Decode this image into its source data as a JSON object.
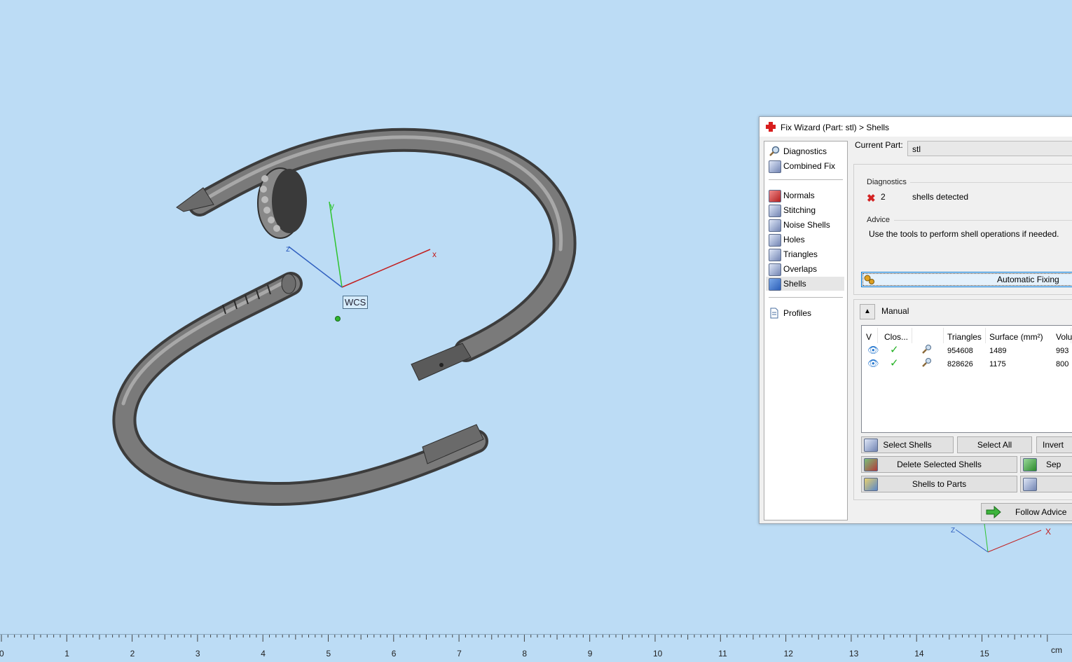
{
  "viewport": {
    "wcs_label": "WCS",
    "axis_x": "x",
    "axis_y": "y",
    "axis_z": "z",
    "mini_axis_x": "X",
    "mini_axis_z": "Z"
  },
  "ruler": {
    "unit": "cm",
    "ticks": [
      "0",
      "1",
      "2",
      "3",
      "4",
      "5",
      "6",
      "7",
      "8",
      "9",
      "10",
      "11",
      "12",
      "13",
      "14",
      "15"
    ]
  },
  "dialog": {
    "title": "Fix Wizard (Part: stl) > Shells",
    "nav": {
      "diagnostics": "Diagnostics",
      "combined_fix": "Combined Fix",
      "normals": "Normals",
      "stitching": "Stitching",
      "noise_shells": "Noise Shells",
      "holes": "Holes",
      "triangles": "Triangles",
      "overlaps": "Overlaps",
      "shells": "Shells",
      "profiles": "Profiles"
    },
    "current_part_label": "Current Part:",
    "current_part_value": "stl",
    "diagnostics_title": "Diagnostics",
    "diag_count": "2",
    "diag_text": "shells detected",
    "advice_title": "Advice",
    "advice_text": "Use the tools to perform shell operations if needed.",
    "automatic_fixing": "Automatic Fixing",
    "manual_label": "Manual",
    "table": {
      "headers": [
        "V",
        "Clos...",
        "",
        "Triangles",
        "Surface (mm²)",
        "Volu"
      ],
      "rows": [
        {
          "triangles": "954608",
          "surface": "1489",
          "volume": "993"
        },
        {
          "triangles": "828626",
          "surface": "1175",
          "volume": "800"
        }
      ]
    },
    "buttons": {
      "select_shells": "Select Shells",
      "select_all": "Select All",
      "invert": "Invert",
      "delete_selected": "Delete Selected Shells",
      "separate": "Sep",
      "shells_to_parts": "Shells to Parts",
      "follow_advice": "Follow Advice"
    }
  }
}
